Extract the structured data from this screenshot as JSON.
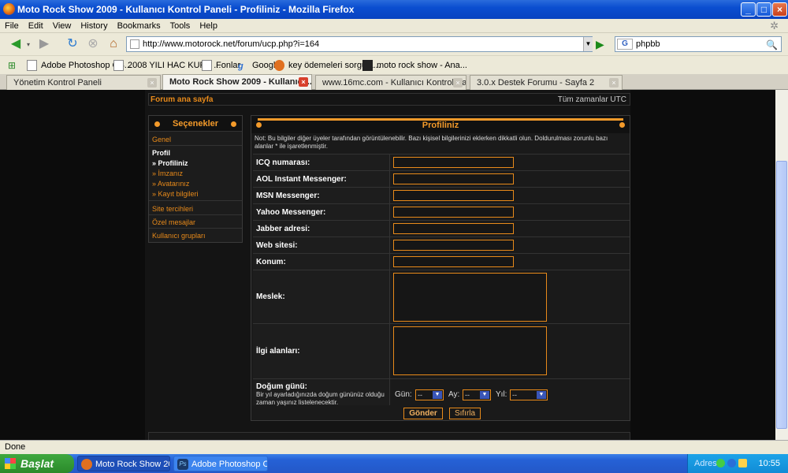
{
  "window": {
    "title": "Moto Rock Show 2009 - Kullanıcı Kontrol Paneli - Profiliniz - Mozilla Firefox"
  },
  "menu": [
    "File",
    "Edit",
    "View",
    "History",
    "Bookmarks",
    "Tools",
    "Help"
  ],
  "nav": {
    "url": "http://www.motorock.net/forum/ucp.php?i=164",
    "search_value": "phpbb",
    "search_engine_letter": "G"
  },
  "bookmarks": [
    "Adobe Photoshop CS...",
    "2008 YILI HAC KURA ...",
    "Fonlar",
    "Google",
    "key ödemeleri sorgula...",
    "moto rock show - Ana..."
  ],
  "tabs": [
    {
      "label": "Yönetim Kontrol Paneli"
    },
    {
      "label": "Moto Rock Show 2009 - Kullanıcı ..."
    },
    {
      "label": "www.16mc.com - Kullanıcı Kontrol Pan..."
    },
    {
      "label": "3.0.x Destek Forumu - Sayfa 2"
    }
  ],
  "forum": {
    "home_link": "Forum ana sayfa",
    "timezone": "Tüm zamanlar UTC"
  },
  "sidebar": {
    "title": "Seçenekler",
    "general": "Genel",
    "profile": "Profil",
    "items": [
      "» Profiliniz",
      "» İmzanız",
      "» Avatarınız",
      "» Kayıt bilgileri"
    ],
    "site_prefs": "Site tercihleri",
    "private_msgs": "Özel mesajlar",
    "groups": "Kullanıcı grupları"
  },
  "panel": {
    "title": "Profiliniz",
    "notice": "Not: Bu bilgiler diğer üyeler tarafından görüntülenebilir. Bazı kişisel bilgilerinizi eklerken dikkatli olun. Doldurulması zorunlu bazı alanlar * ile işaretlenmiştir.",
    "fields": [
      "ICQ numarası:",
      "AOL Instant Messenger:",
      "MSN Messenger:",
      "Yahoo Messenger:",
      "Jabber adresi:",
      "Web sitesi:",
      "Konum:"
    ],
    "occupation": "Meslek:",
    "interests": "İlgi alanları:",
    "birthday": {
      "label": "Doğum günü:",
      "desc": "Bir yıl ayarladığınızda doğum gününüz olduğu zaman yaşınız listelenecektir.",
      "day_label": "Gün:",
      "month_label": "Ay:",
      "year_label": "Yıl:",
      "day": "--",
      "month": "--",
      "year": "--"
    },
    "submit": "Gönder",
    "reset": "Sıfırla"
  },
  "status": "Done",
  "taskbar": {
    "start": "Başlat",
    "tasks": [
      "Moto Rock Show 200...",
      "Adobe Photoshop CS..."
    ],
    "tray_label": "Adres",
    "clock": "10:55"
  },
  "colors": {
    "accent": "#f39a2a",
    "page_bg": "#0c0c0c",
    "titlebar": "#0a4ed0"
  }
}
